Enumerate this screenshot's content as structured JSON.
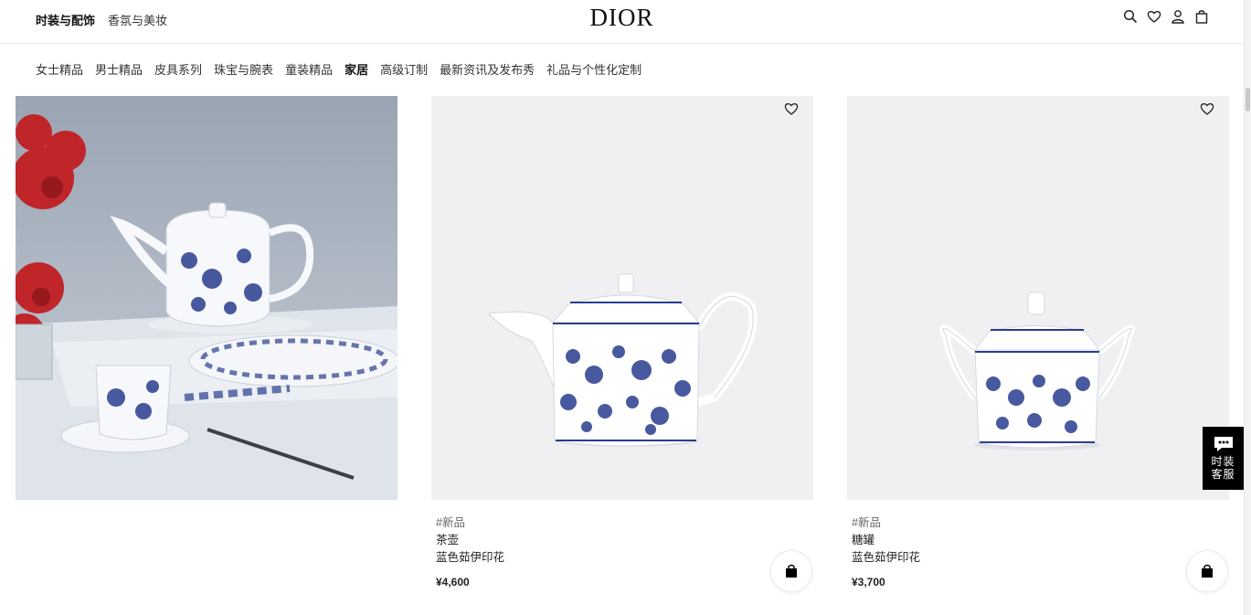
{
  "header": {
    "left_links": [
      "时装与配饰",
      "香氛与美妆"
    ],
    "logo": "DIOR",
    "icons": [
      "search-icon",
      "heart-icon",
      "user-icon",
      "bag-icon"
    ]
  },
  "nav": {
    "items": [
      "女士精品",
      "男士精品",
      "皮具系列",
      "珠宝与腕表",
      "童装精品",
      "家居",
      "高级订制",
      "最新资讯及发布秀",
      "礼品与个性化定制"
    ],
    "active": "家居"
  },
  "products": [
    {
      "tag": "#新品",
      "name": "茶壶",
      "collection": "蓝色茹伊印花",
      "price": "¥4,600"
    },
    {
      "tag": "#新品",
      "name": "糖罐",
      "collection": "蓝色茹伊印花",
      "price": "¥3,700"
    }
  ],
  "chat": {
    "label": "时装客服"
  },
  "colors": {
    "accent": "#000000",
    "card_bg": "#f0f0f2",
    "porcelain_blue": "#2a3d8f"
  }
}
